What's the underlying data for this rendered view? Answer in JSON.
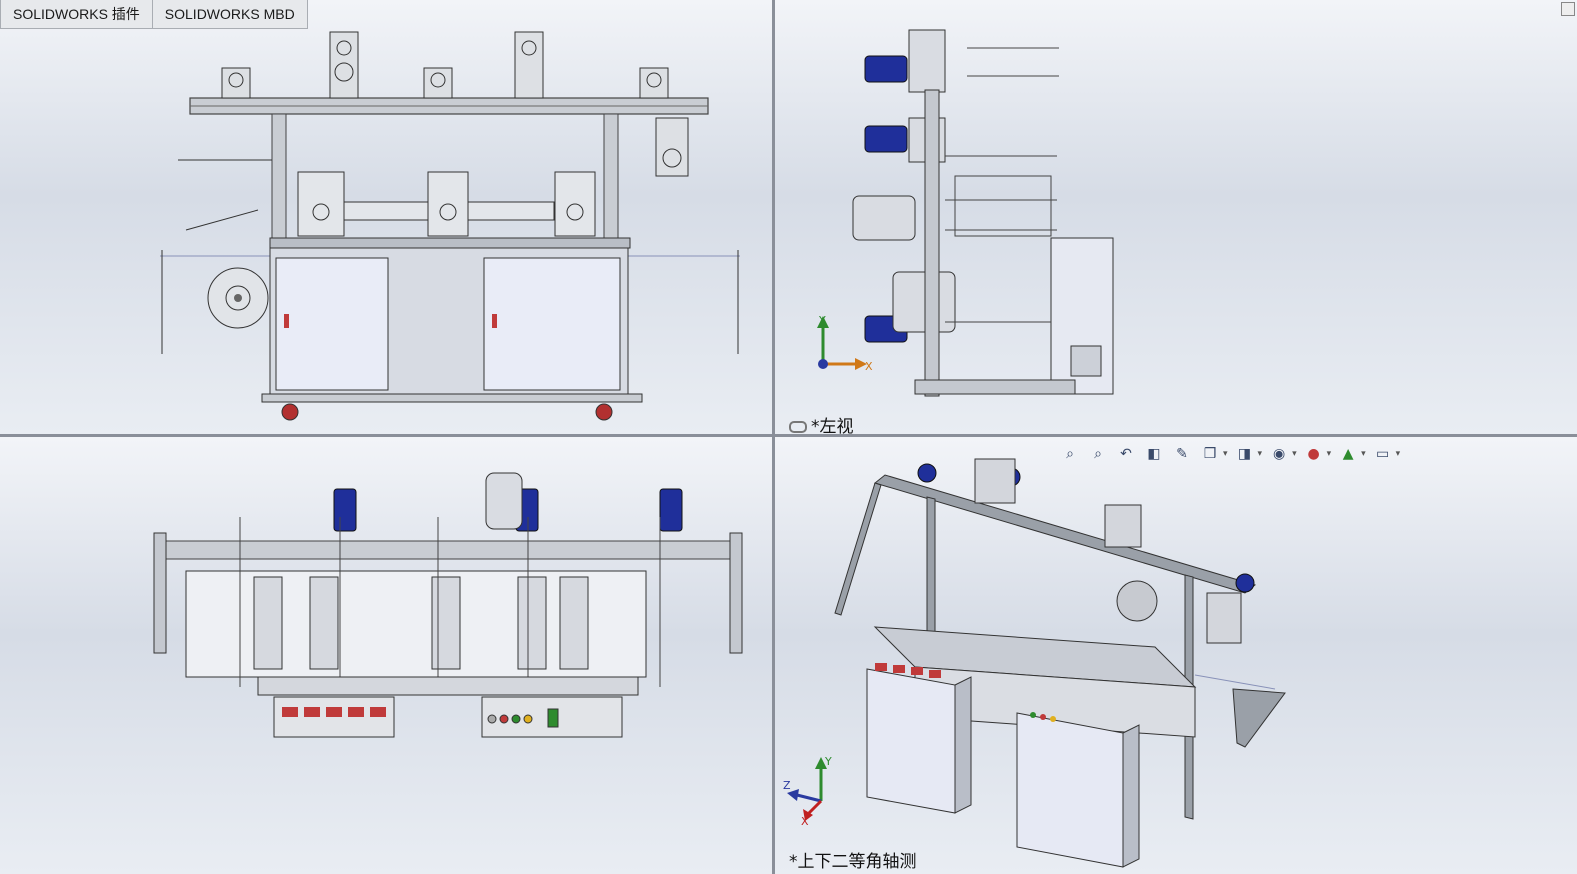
{
  "tabs": [
    "SOLIDWORKS 插件",
    "SOLIDWORKS MBD"
  ],
  "views": {
    "top_right_label": "*左视",
    "bottom_right_label": "*上下二等角轴测"
  },
  "hud_icons": [
    "zoom-to-fit-icon",
    "zoom-area-icon",
    "previous-view-icon",
    "section-view-icon",
    "dynamic-annotation-icon",
    "view-orientation-icon",
    "display-style-icon",
    "hide-show-items-icon",
    "edit-appearance-icon",
    "apply-scene-icon",
    "view-settings-icon"
  ],
  "triad": {
    "x": "X",
    "y": "Y",
    "z": "Z"
  },
  "colors": {
    "motor_blue": "#1f2f9a",
    "frame_gray": "#9aa0a8",
    "cabinet": "#e6e9f5",
    "panel_red": "#c03a3a"
  }
}
